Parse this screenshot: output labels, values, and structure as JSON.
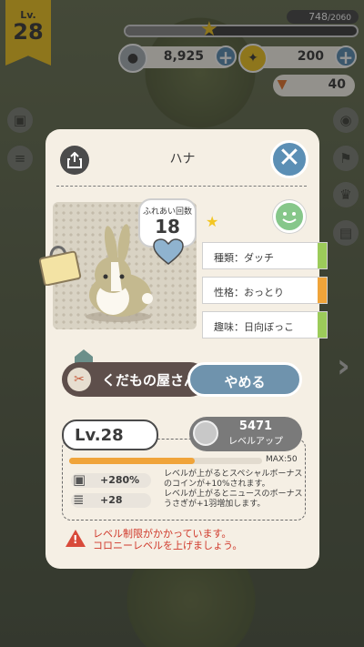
{
  "hud": {
    "level_label": "Lv.",
    "level": "28",
    "xp_current": "748",
    "xp_max": "/2060",
    "xp_progress": 0.36,
    "coins": "8,925",
    "gold": "200",
    "carrots": "40"
  },
  "dialog": {
    "name": "ハナ",
    "affection_label": "ふれあい回数",
    "affection_count": "18",
    "traits": [
      {
        "text": "種類：ダッチ",
        "tab_color": "#9ccb5a"
      },
      {
        "text": "性格：おっとり",
        "tab_color": "#f0a43a"
      },
      {
        "text": "趣味：日向ぼっこ",
        "tab_color": "#9ccb5a"
      }
    ],
    "workplace": "くだもの屋さん",
    "quit_label": "やめる",
    "level_text": "Lv.28",
    "levelup_cost": "5471",
    "levelup_label": "レベルアップ",
    "level_progress": 0.65,
    "max_label": "MAX:50",
    "bonuses": [
      {
        "icon": "box-icon",
        "value": "+280%",
        "desc": "レベルが上がるとスペシャルボーナスのコインが+10%されます。"
      },
      {
        "icon": "newspaper-icon",
        "value": "+28",
        "desc": "レベルが上がるとニュースのボーナスうさぎが+1羽増加します。"
      }
    ],
    "warning_line1": "レベル制限がかかっています。",
    "warning_line2": "コロニーレベルを上げましょう。"
  },
  "colors": {
    "accent_blue": "#5b8fb5",
    "brown": "#5e4f4b",
    "warning": "#d0392b"
  }
}
